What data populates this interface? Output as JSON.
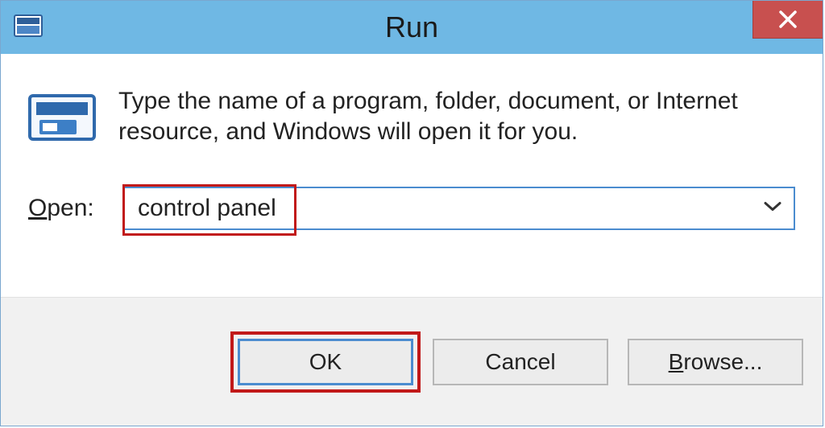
{
  "window": {
    "title": "Run",
    "description": "Type the name of a program, folder, document, or Internet resource, and Windows will open it for you.",
    "open_label_pre": "O",
    "open_label_rest": "pen:",
    "open_value": "control panel"
  },
  "buttons": {
    "ok": "OK",
    "cancel": "Cancel",
    "browse_underline": "B",
    "browse_rest": "rowse..."
  }
}
